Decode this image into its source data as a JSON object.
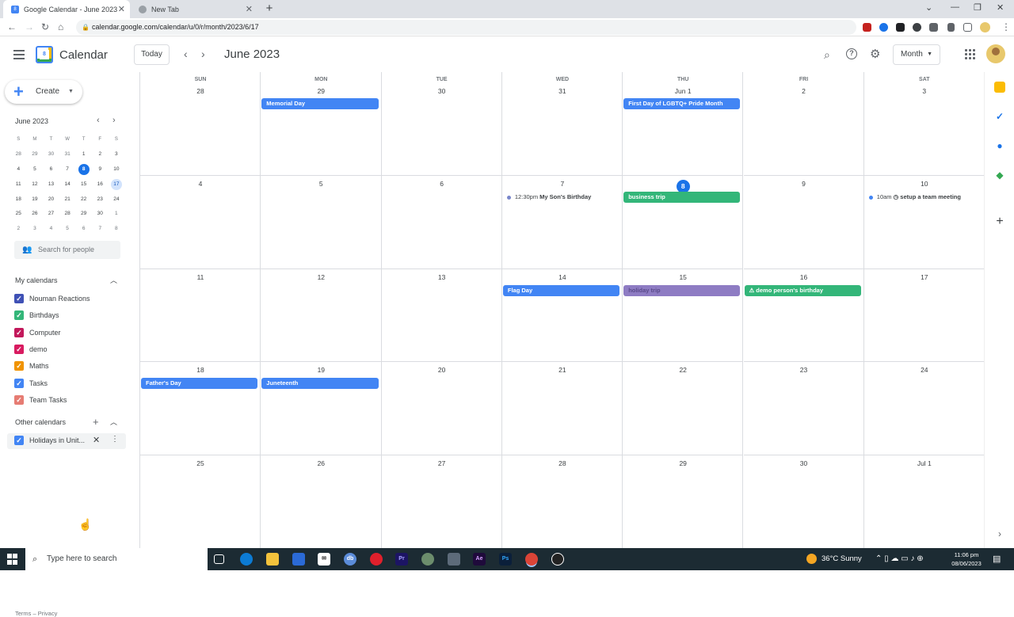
{
  "browser": {
    "tabs": [
      {
        "title": "Google Calendar - June 2023",
        "active": true
      },
      {
        "title": "New Tab",
        "active": false
      }
    ],
    "url": "calendar.google.com/calendar/u/0/r/month/2023/6/17"
  },
  "header": {
    "app_title": "Calendar",
    "today_label": "Today",
    "month_title": "June 2023",
    "view_label": "Month"
  },
  "sidebar": {
    "create_label": "Create",
    "mini_title": "June 2023",
    "mini_dow": [
      "S",
      "M",
      "T",
      "W",
      "T",
      "F",
      "S"
    ],
    "mini_weeks": [
      [
        "28",
        "29",
        "30",
        "31",
        "1",
        "2",
        "3"
      ],
      [
        "4",
        "5",
        "6",
        "7",
        "8",
        "9",
        "10"
      ],
      [
        "11",
        "12",
        "13",
        "14",
        "15",
        "16",
        "17"
      ],
      [
        "18",
        "19",
        "20",
        "21",
        "22",
        "23",
        "24"
      ],
      [
        "25",
        "26",
        "27",
        "28",
        "29",
        "30",
        "1"
      ],
      [
        "2",
        "3",
        "4",
        "5",
        "6",
        "7",
        "8"
      ]
    ],
    "people_search_placeholder": "Search for people",
    "my_calendars_title": "My calendars",
    "my_calendars": [
      {
        "label": "Nouman Reactions",
        "color": "#3f51b5"
      },
      {
        "label": "Birthdays",
        "color": "#33b679"
      },
      {
        "label": "Computer",
        "color": "#c2185b"
      },
      {
        "label": "demo",
        "color": "#d81b60"
      },
      {
        "label": "Maths",
        "color": "#f09300"
      },
      {
        "label": "Tasks",
        "color": "#4285f4"
      },
      {
        "label": "Team Tasks",
        "color": "#e67c73"
      }
    ],
    "other_calendars_title": "Other calendars",
    "other_calendars": [
      {
        "label": "Holidays in Unit...",
        "color": "#4285f4"
      }
    ],
    "footer": "Terms – Privacy"
  },
  "grid": {
    "dow": [
      "SUN",
      "MON",
      "TUE",
      "WED",
      "THU",
      "FRI",
      "SAT"
    ],
    "weeks": [
      [
        "28",
        "29",
        "30",
        "31",
        "Jun 1",
        "2",
        "3"
      ],
      [
        "4",
        "5",
        "6",
        "7",
        "8",
        "9",
        "10"
      ],
      [
        "11",
        "12",
        "13",
        "14",
        "15",
        "16",
        "17"
      ],
      [
        "18",
        "19",
        "20",
        "21",
        "22",
        "23",
        "24"
      ],
      [
        "25",
        "26",
        "27",
        "28",
        "29",
        "30",
        "Jul 1"
      ]
    ],
    "events": [
      {
        "week": 0,
        "day": 1,
        "title": "Memorial Day",
        "color": "#4285f4",
        "type": "allday"
      },
      {
        "week": 0,
        "day": 4,
        "title": "First Day of LGBTQ+ Pride Month",
        "color": "#4285f4",
        "type": "allday"
      },
      {
        "week": 1,
        "day": 3,
        "time": "12:30pm",
        "title": "My Son's Birthday",
        "color": "#7986cb",
        "type": "timed"
      },
      {
        "week": 1,
        "day": 4,
        "title": "business trip",
        "color": "#33b679",
        "type": "allday"
      },
      {
        "week": 1,
        "day": 6,
        "time": "10am",
        "title": "◷ setup a team meeting",
        "color": "#4285f4",
        "type": "timed"
      },
      {
        "week": 2,
        "day": 3,
        "title": "Flag Day",
        "color": "#4285f4",
        "type": "allday"
      },
      {
        "week": 2,
        "day": 4,
        "title": "holiday trip",
        "color": "#8e7cc3",
        "type": "allday",
        "text_color": "#5a4a8a"
      },
      {
        "week": 2,
        "day": 5,
        "title": "⚠ demo person's birthday",
        "color": "#33b679",
        "type": "allday"
      },
      {
        "week": 3,
        "day": 0,
        "title": "Father's Day",
        "color": "#4285f4",
        "type": "allday"
      },
      {
        "week": 3,
        "day": 1,
        "title": "Juneteenth",
        "color": "#4285f4",
        "type": "allday"
      }
    ]
  },
  "taskbar": {
    "search_placeholder": "Type here to search",
    "weather": "36°C  Sunny",
    "time": "11:06 pm",
    "date": "08/06/2023"
  }
}
